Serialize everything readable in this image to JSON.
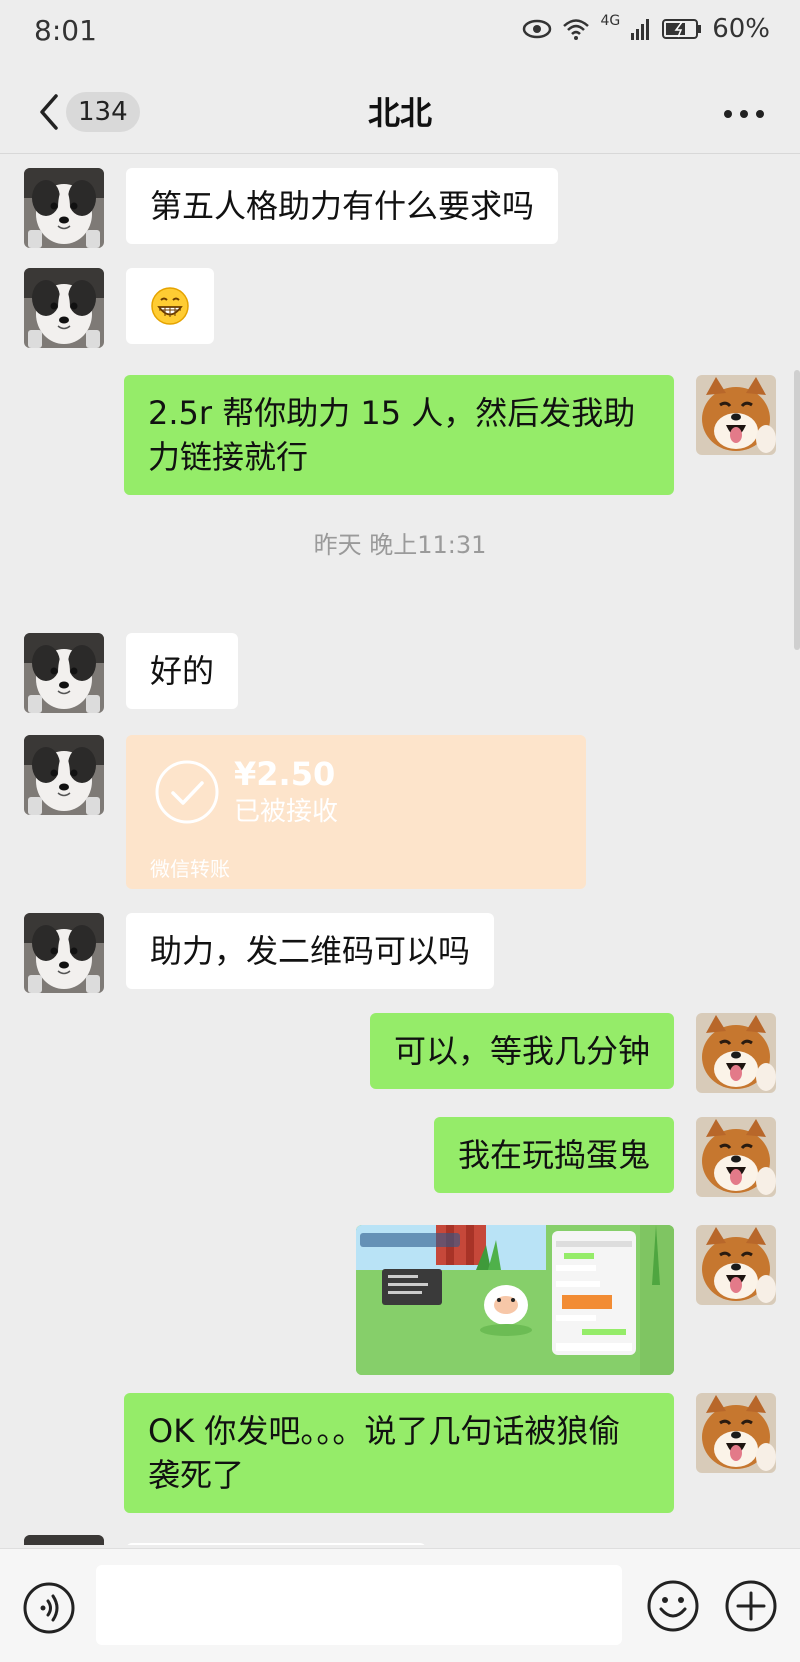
{
  "status_bar": {
    "time": "8:01",
    "network": "4G",
    "battery": "60%"
  },
  "header": {
    "back_badge": "134",
    "title": "北北"
  },
  "messages": [
    {
      "side": "in",
      "type": "text",
      "text": "第五人格助力有什么要求吗"
    },
    {
      "side": "in",
      "type": "emoji",
      "emoji": "grinning-face"
    },
    {
      "side": "out",
      "type": "text",
      "text": "2.5r 帮你助力 15 人，然后发我助力链接就行"
    },
    {
      "type": "timestamp",
      "text": "昨天 晚上11:31"
    },
    {
      "side": "in",
      "type": "text",
      "text": "好的"
    },
    {
      "side": "in",
      "type": "transfer",
      "amount": "¥2.50",
      "status": "已被接收",
      "source": "微信转账"
    },
    {
      "side": "in",
      "type": "text",
      "text": "助力，发二维码可以吗"
    },
    {
      "side": "out",
      "type": "text",
      "text": "可以，等我几分钟"
    },
    {
      "side": "out",
      "type": "text",
      "text": "我在玩捣蛋鬼"
    },
    {
      "side": "out",
      "type": "image",
      "description": "game-screenshot"
    },
    {
      "side": "out",
      "type": "text",
      "text": "OK 你发吧。。。说了几句话被狼偷袭死了"
    }
  ],
  "colors": {
    "out_bubble": "#95ec69",
    "in_bubble": "#ffffff",
    "background": "#ededed",
    "transfer_bg": "#fde4cb"
  },
  "input": {
    "placeholder": ""
  }
}
